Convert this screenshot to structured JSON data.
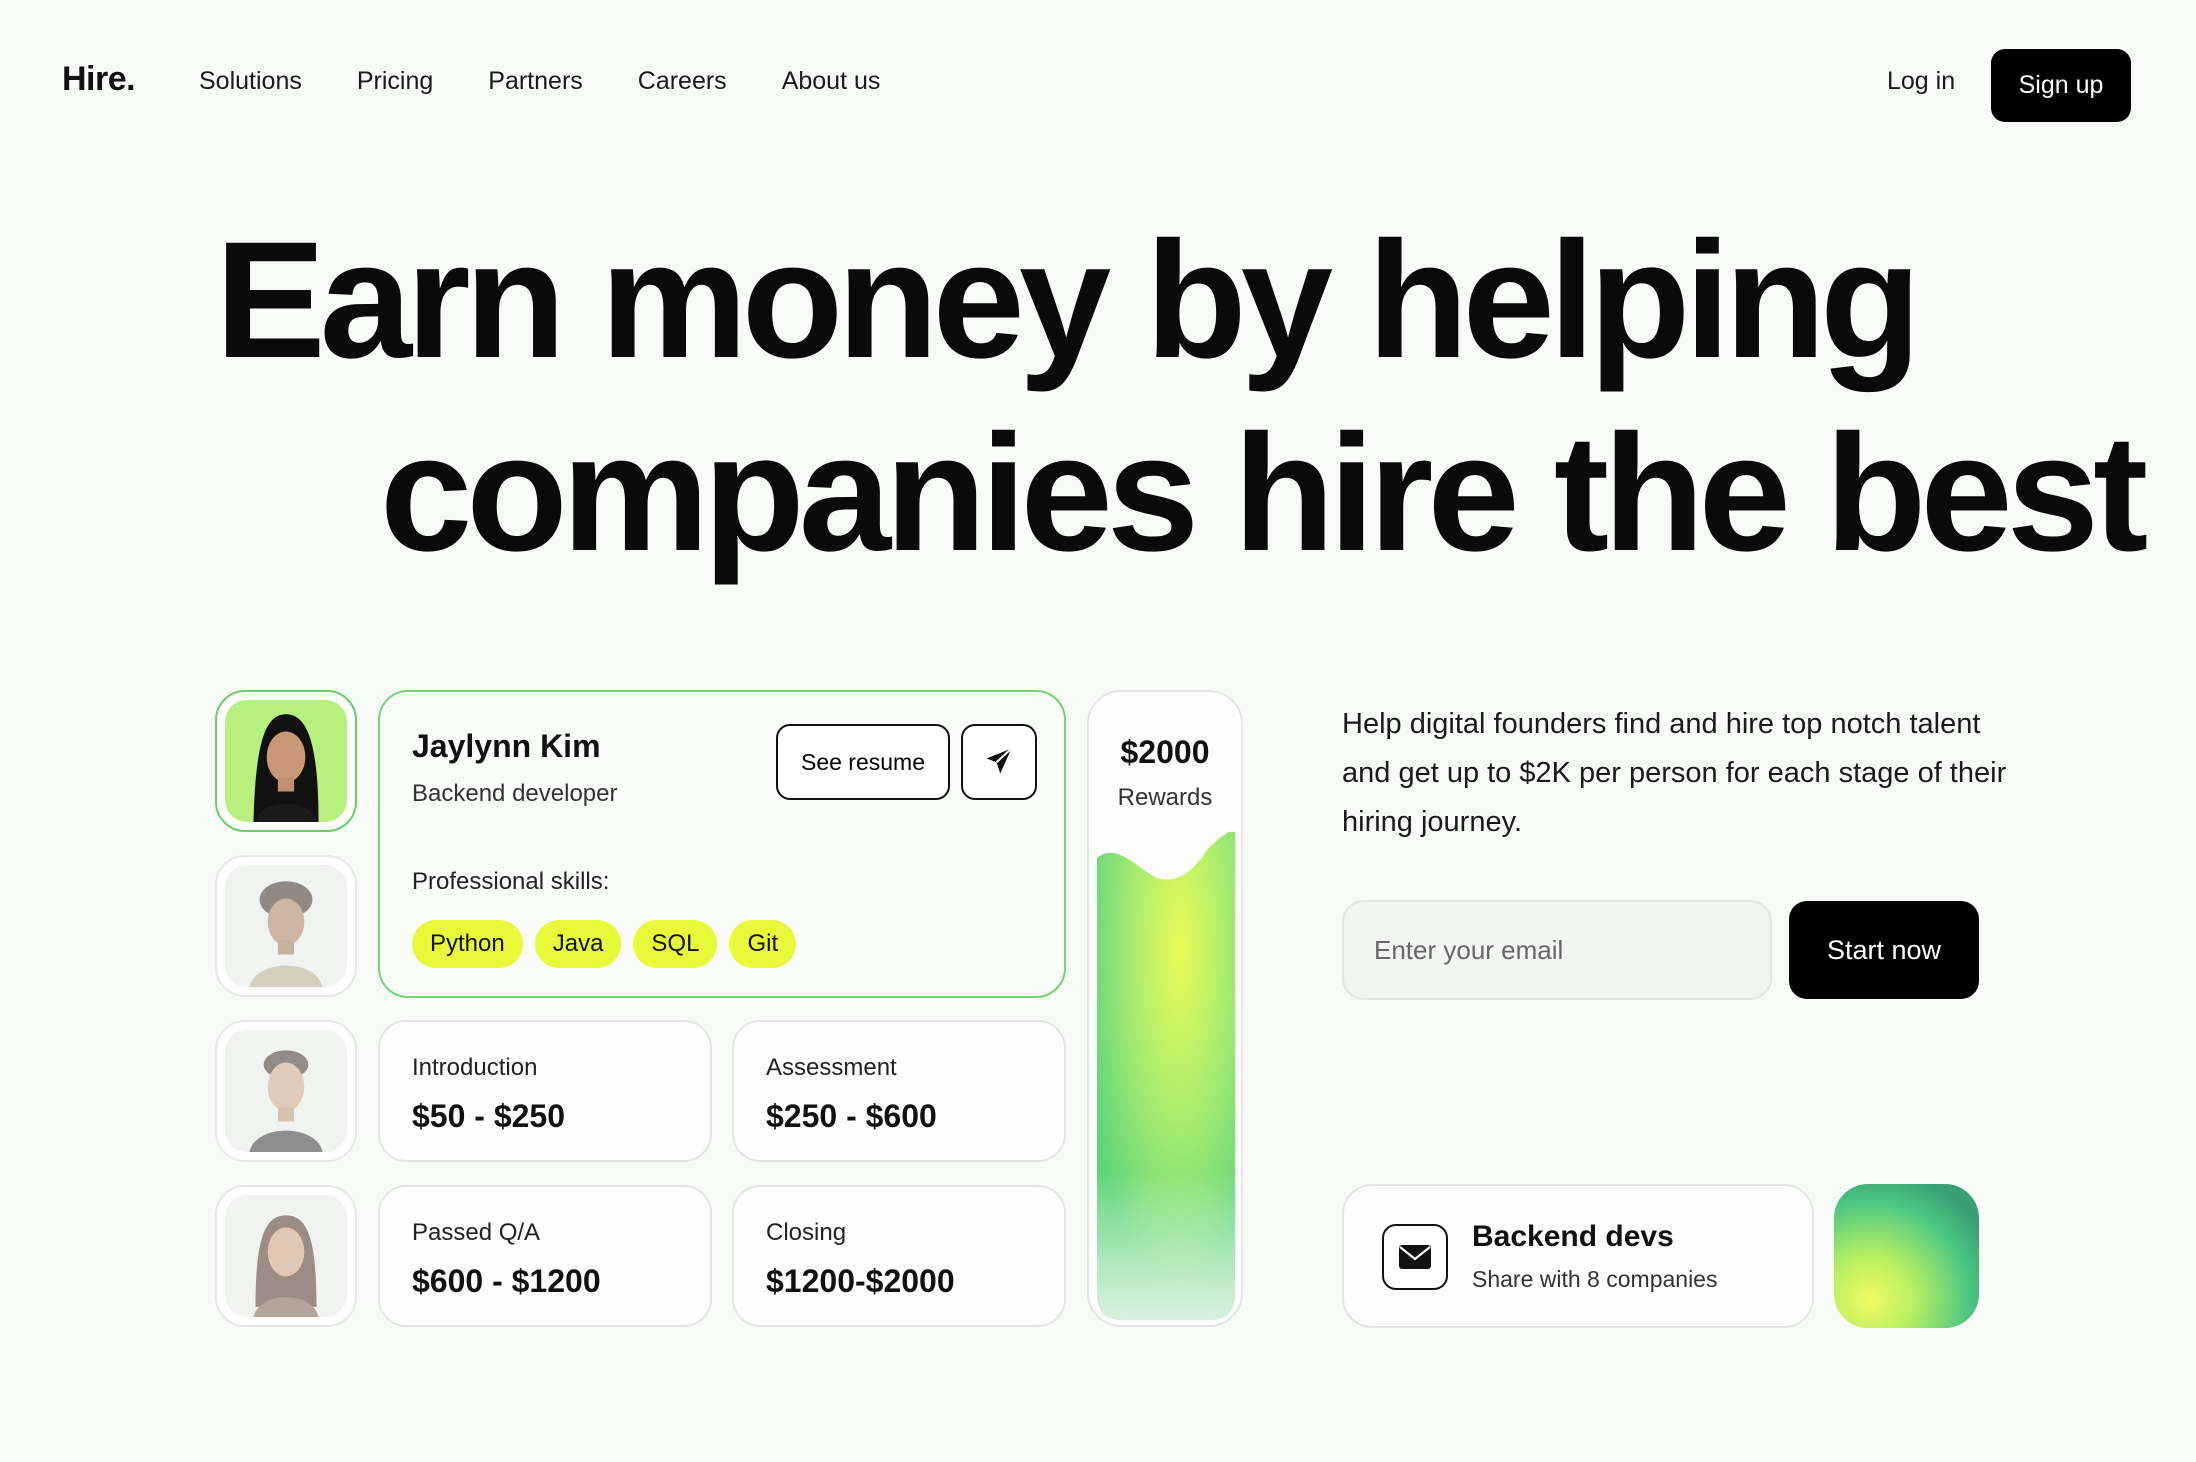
{
  "nav": {
    "logo": "Hire.",
    "links": [
      "Solutions",
      "Pricing",
      "Partners",
      "Careers",
      "About us"
    ],
    "login": "Log in",
    "signup": "Sign up"
  },
  "hero": {
    "line1": "Earn money by helping",
    "line2": "companies hire the best"
  },
  "candidate": {
    "name": "Jaylynn Kim",
    "role": "Backend developer",
    "see_resume": "See resume",
    "skills_label": "Professional skills:",
    "skills": [
      "Python",
      "Java",
      "SQL",
      "Git"
    ]
  },
  "stages": [
    {
      "label": "Introduction",
      "value": "$50 - $250"
    },
    {
      "label": "Assessment",
      "value": "$250 - $600"
    },
    {
      "label": "Passed Q/A",
      "value": "$600 - $1200"
    },
    {
      "label": "Closing",
      "value": "$1200-$2000"
    }
  ],
  "rewards": {
    "amount": "$2000",
    "label": "Rewards"
  },
  "description": "Help digital founders find and hire top notch talent and get up to $2K per person for each stage of their hiring journey.",
  "signup_form": {
    "email_placeholder": "Enter your email",
    "cta": "Start now"
  },
  "notification": {
    "title": "Backend devs",
    "subtitle": "Share with 8 companies"
  },
  "colors": {
    "accent_green": "#6fd86f",
    "chip_yellow": "#e8f93a",
    "primary_button": "#000000"
  },
  "icons": {
    "send": "paper-plane-icon",
    "mail": "envelope-icon"
  }
}
